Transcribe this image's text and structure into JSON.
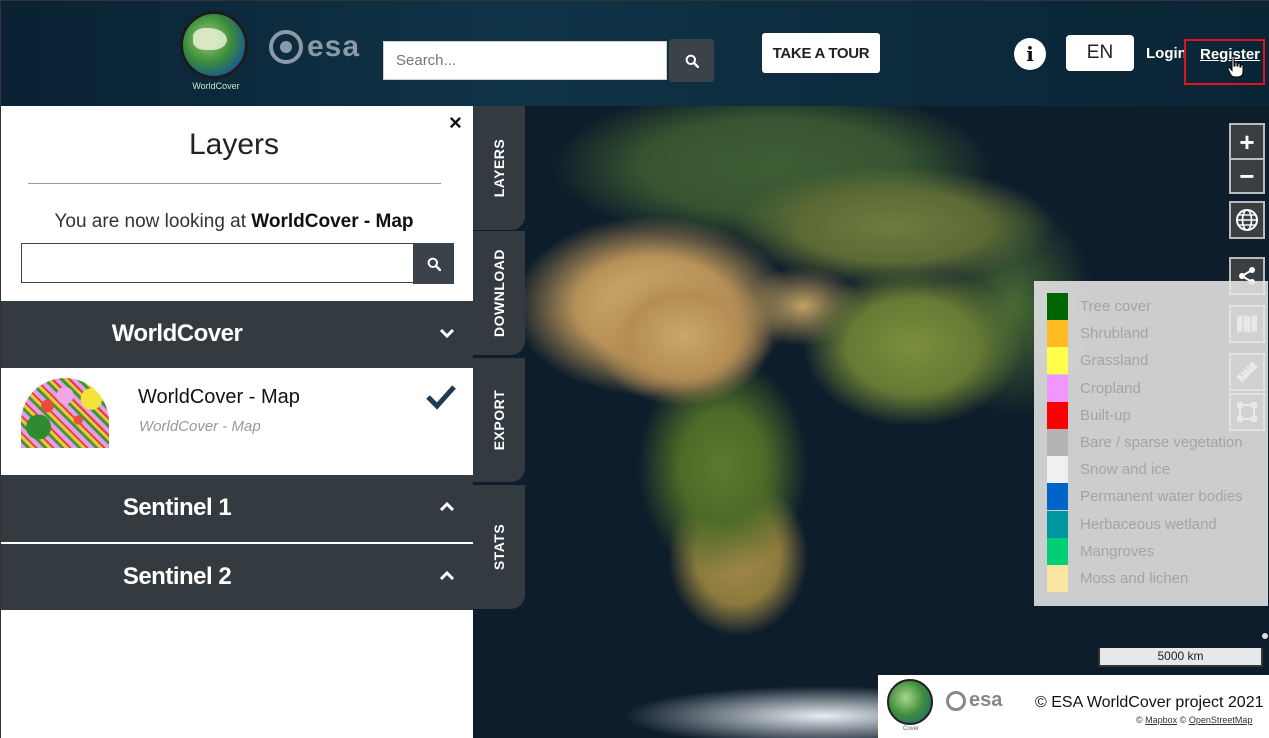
{
  "header": {
    "logo_caption": "WorldCover",
    "esa_text": "esa",
    "search_placeholder": "Search...",
    "tour_label": "TAKE A TOUR",
    "info_symbol": "i",
    "lang_label": "EN",
    "login_label": "Login",
    "register_label": "Register"
  },
  "panel": {
    "close_symbol": "×",
    "title": "Layers",
    "looking_prefix": "You are now looking at ",
    "looking_layer": "WorldCover - Map",
    "groups": [
      {
        "name": "WorldCover",
        "state": "expanded"
      },
      {
        "name": "Sentinel 1",
        "state": "collapsed"
      },
      {
        "name": "Sentinel 2",
        "state": "collapsed"
      }
    ],
    "layer": {
      "name": "WorldCover - Map",
      "subtitle": "WorldCover - Map",
      "selected": true
    }
  },
  "tabs": [
    "LAYERS",
    "DOWNLOAD",
    "EXPORT",
    "STATS"
  ],
  "legend": [
    {
      "label": "Tree cover",
      "color": "#006400"
    },
    {
      "label": "Shrubland",
      "color": "#ffbb22"
    },
    {
      "label": "Grassland",
      "color": "#ffff4c"
    },
    {
      "label": "Cropland",
      "color": "#f096ff"
    },
    {
      "label": "Built-up",
      "color": "#fa0000"
    },
    {
      "label": "Bare / sparse vegetation",
      "color": "#b4b4b4"
    },
    {
      "label": "Snow and ice",
      "color": "#f0f0f0"
    },
    {
      "label": "Permanent water bodies",
      "color": "#0064c8"
    },
    {
      "label": "Herbaceous wetland",
      "color": "#0096a0"
    },
    {
      "label": "Mangroves",
      "color": "#00cf75"
    },
    {
      "label": "Moss and lichen",
      "color": "#fae6a0"
    }
  ],
  "map": {
    "zoom_in": "+",
    "zoom_out": "−",
    "scale": "5000 km",
    "copyright": "© ESA WorldCover project 2021",
    "credit_prefix": "© ",
    "credit_mapbox": "Mapbox",
    "credit_mid": " © ",
    "credit_osm": "OpenStreetMap",
    "attrib_logo_caption": "Cover"
  },
  "colors": {
    "header_bg": "#0f3347",
    "panel_dark": "#343b40",
    "register_outline": "#e0141e"
  }
}
